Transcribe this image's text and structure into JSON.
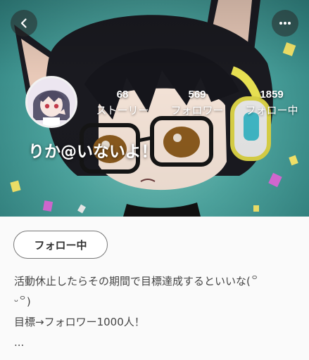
{
  "header": {
    "back_icon": "chevron-left-icon",
    "more_icon": "more-horizontal-icon"
  },
  "profile": {
    "username": "りか@いないよ！",
    "stats": [
      {
        "value": "68",
        "label": "ストーリー"
      },
      {
        "value": "569",
        "label": "フォロワー"
      },
      {
        "value": "1859",
        "label": "フォロー中"
      }
    ]
  },
  "actions": {
    "follow_button_label": "フォロー中"
  },
  "bio": {
    "lines": [
      "活動休止したらその期間で目標達成するといいな(꒪",
      "ᵕ꒪)",
      "目標→フォロワー1000人！",
      "..."
    ]
  },
  "colors": {
    "hero_teal": "#4fa8a2",
    "text_dark": "#333333",
    "page_bg": "#fafafa"
  }
}
